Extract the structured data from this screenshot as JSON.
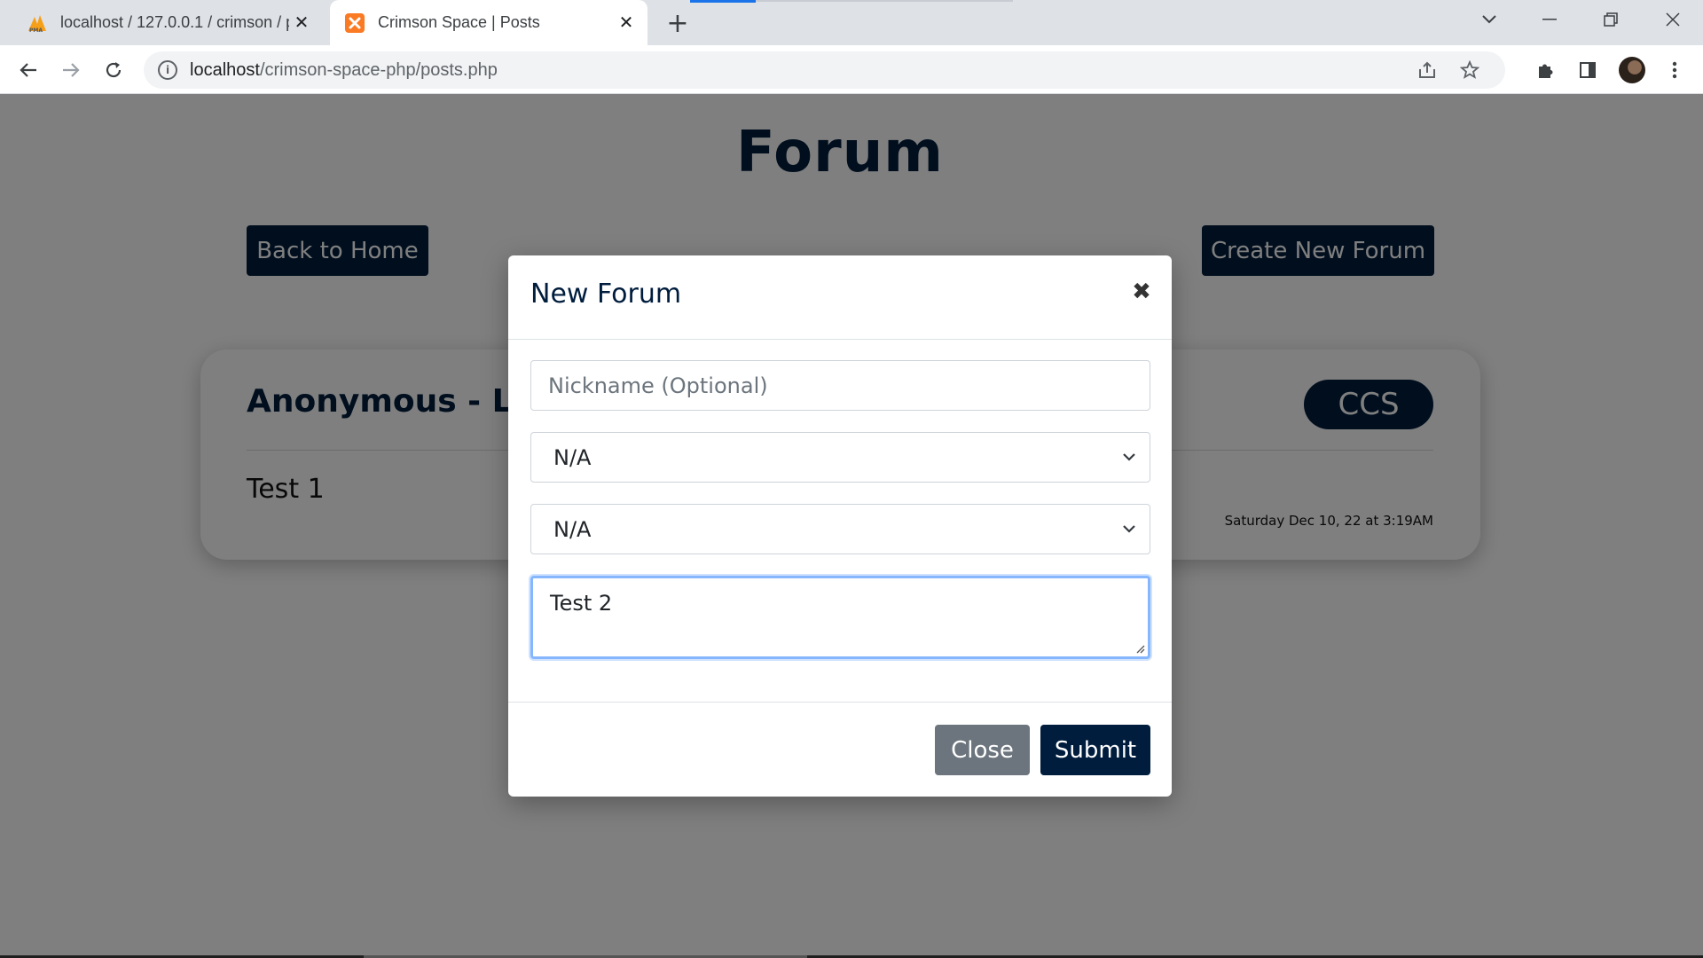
{
  "browser": {
    "tabs": [
      {
        "title": "localhost / 127.0.0.1 / crimson / p",
        "favicon": "phpmyadmin-icon",
        "active": false
      },
      {
        "title": "Crimson Space | Posts",
        "favicon": "xampp-icon",
        "active": true
      }
    ],
    "new_tab_label": "+",
    "url_host": "localhost",
    "url_path": "/crimson-space-php/posts.php"
  },
  "page": {
    "title": "Forum",
    "back_button": "Back to Home",
    "create_button": "Create New Forum",
    "post": {
      "author": "Anonymous - L3",
      "badge": "CCS",
      "body": "Test 1",
      "date": "Saturday Dec 10, 22 at 3:19AM"
    }
  },
  "modal": {
    "title": "New Forum",
    "close_symbol": "✖",
    "nickname_placeholder": "Nickname (Optional)",
    "select1_value": "N/A",
    "select2_value": "N/A",
    "content_value": "Test 2",
    "close_button": "Close",
    "submit_button": "Submit"
  },
  "colors": {
    "brand_navy": "#001d3d",
    "secondary_gray": "#6c757d",
    "focus_blue": "#86b7fe"
  }
}
